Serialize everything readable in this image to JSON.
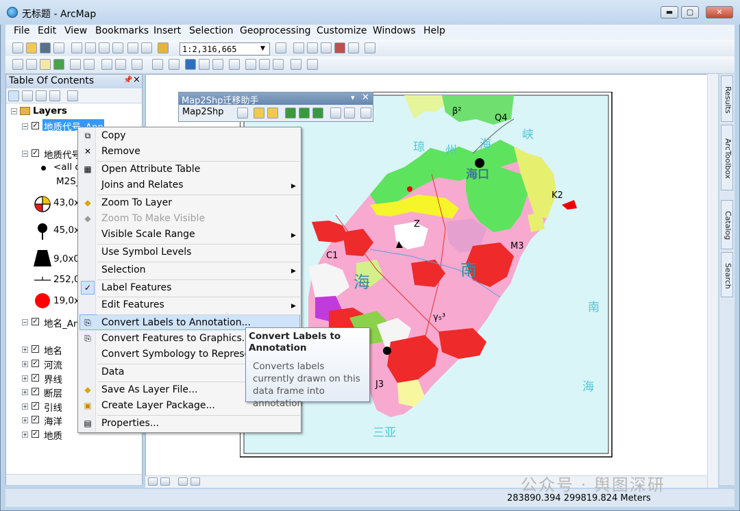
{
  "window": {
    "title": "无标题 - ArcMap",
    "min": "▬",
    "max": "▢",
    "close": "✕"
  },
  "menubar": [
    "File",
    "Edit",
    "View",
    "Bookmarks",
    "Insert",
    "Selection",
    "Geoprocessing",
    "Customize",
    "Windows",
    "Help"
  ],
  "toolbar": {
    "scale": "1:2,316,665"
  },
  "toc": {
    "title": "Table Of Contents",
    "root": "Layers",
    "items": [
      {
        "label": "地质代号_Ann"
      },
      {
        "label": "地质代号_"
      },
      {
        "label": "<all o"
      },
      {
        "label": "M2S_"
      },
      {
        "label": "43,0x"
      },
      {
        "label": "45,0x"
      },
      {
        "label": "9,0x0"
      },
      {
        "label": "252,0"
      },
      {
        "label": "19,0x"
      },
      {
        "label": "地名_An"
      },
      {
        "label": "地名"
      },
      {
        "label": "河流"
      },
      {
        "label": "界线"
      },
      {
        "label": "断层"
      },
      {
        "label": "引线"
      },
      {
        "label": "海洋"
      },
      {
        "label": "地质"
      }
    ]
  },
  "context_menu": {
    "items": [
      {
        "label": "Copy",
        "icon": "copy-icon"
      },
      {
        "label": "Remove",
        "icon": "remove-icon"
      },
      {
        "label": "Open Attribute Table",
        "icon": "table-icon"
      },
      {
        "label": "Joins and Relates",
        "submenu": true
      },
      {
        "label": "Zoom To Layer",
        "icon": "zoom-layer-icon"
      },
      {
        "label": "Zoom To Make Visible",
        "disabled": true
      },
      {
        "label": "Visible Scale Range",
        "submenu": true
      },
      {
        "label": "Use Symbol Levels"
      },
      {
        "label": "Selection",
        "submenu": true
      },
      {
        "label": "Label Features",
        "checked": true
      },
      {
        "label": "Edit Features",
        "submenu": true
      },
      {
        "label": "Convert Labels to Annotation...",
        "highlighted": true
      },
      {
        "label": "Convert Features to Graphics..."
      },
      {
        "label": "Convert Symbology to Represen"
      },
      {
        "label": "Data",
        "submenu": true
      },
      {
        "label": "Save As Layer File..."
      },
      {
        "label": "Create Layer Package..."
      },
      {
        "label": "Properties..."
      }
    ]
  },
  "tooltip": {
    "title": "Convert Labels to Annotation",
    "body": "Converts labels currently drawn on this data frame into annotation"
  },
  "m2s_toolbar": {
    "title": "Map2Shp迁移助手",
    "button": "Map2Shp"
  },
  "map_labels": [
    "琼",
    "州",
    "海",
    "峡",
    "海口",
    "南",
    "海",
    "南",
    "三亚",
    "海",
    "β²",
    "Q4",
    "K2",
    "M3",
    "J3",
    "C1",
    "Z",
    "γ₅³"
  ],
  "right_dock": [
    "Results",
    "ArcToolbox",
    "Catalog",
    "Search"
  ],
  "status": {
    "coords": "283890.394  299819.824 Meters"
  },
  "watermark": "公众号 · 舆图深研"
}
